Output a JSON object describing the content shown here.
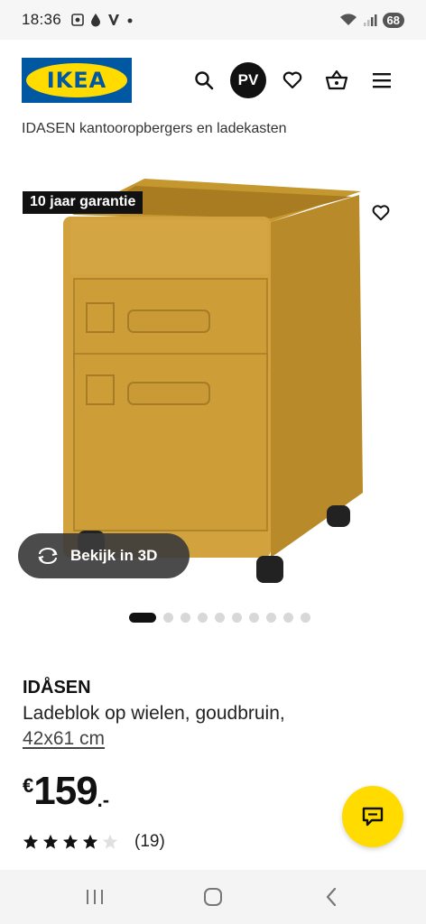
{
  "status_bar": {
    "time": "18:36",
    "battery": "68",
    "icons": [
      "screenshot-icon",
      "drop-icon",
      "v-app-icon",
      "dot-icon",
      "wifi-icon",
      "signal-icon"
    ]
  },
  "header": {
    "logo_text": "IKEA",
    "avatar_initials": "PV",
    "icons": [
      "search-icon",
      "heart-icon",
      "basket-icon",
      "menu-icon"
    ]
  },
  "breadcrumb": "IDASEN kantooropbergers en ladekasten",
  "product_image": {
    "badge": "10 jaar garantie",
    "view_3d_label": "Bekijk in 3D",
    "carousel": {
      "total": 10,
      "active_index": 0
    }
  },
  "product": {
    "name": "IDÅSEN",
    "description": "Ladeblok op wielen, goudbruin,",
    "size": "42x61 cm",
    "price_currency": "€",
    "price_integer": "159",
    "price_decimal": ".-",
    "rating_value": 4,
    "rating_max": 5,
    "rating_count": "(19)"
  },
  "colors": {
    "ikea_blue": "#0058a3",
    "ikea_yellow": "#ffdb00",
    "cabinet_gold": "#d1a23d"
  }
}
